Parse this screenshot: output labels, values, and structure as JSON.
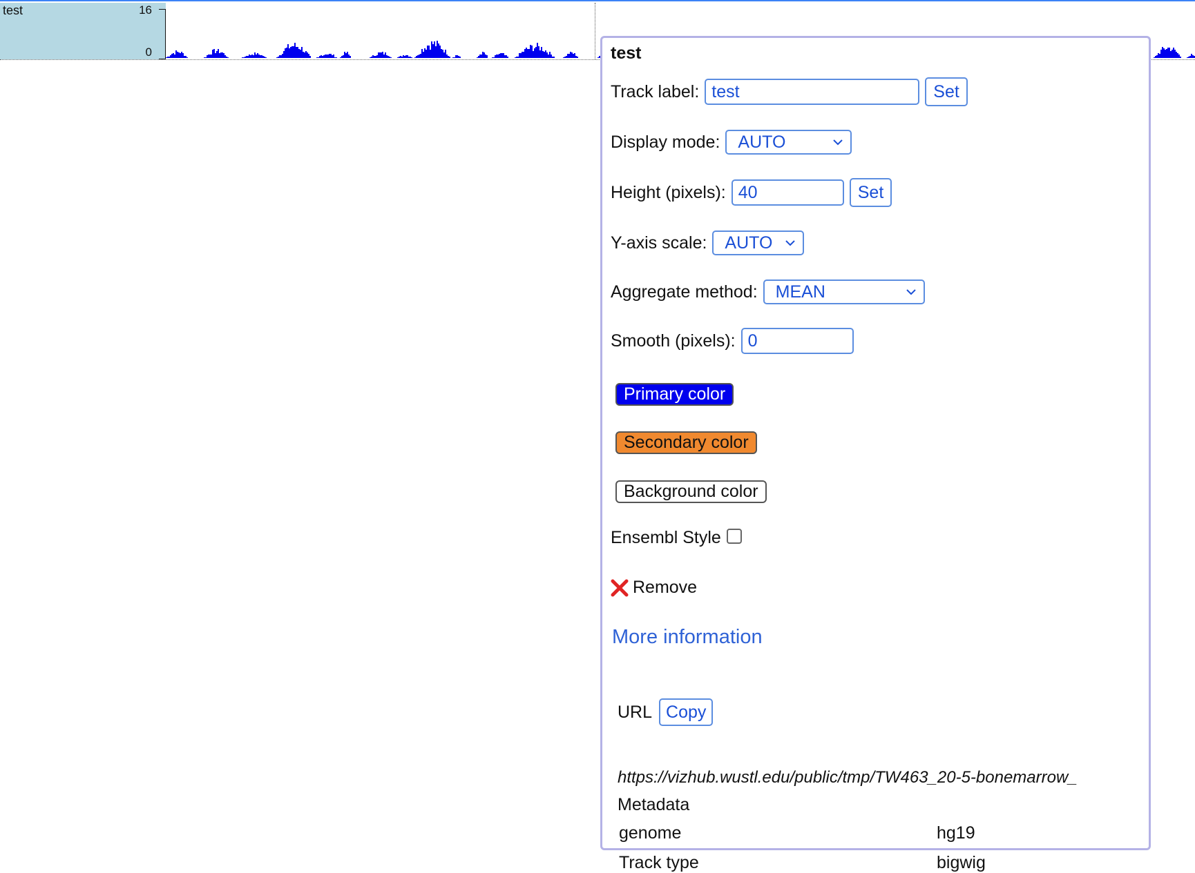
{
  "track": {
    "label": "test",
    "ymax": "16",
    "ymin": "0",
    "color": "#0000ee"
  },
  "panel": {
    "title": "test",
    "track_label": {
      "label": "Track label:",
      "value": "test",
      "set_label": "Set"
    },
    "display_mode": {
      "label": "Display mode:",
      "value": "AUTO"
    },
    "height": {
      "label": "Height (pixels):",
      "value": "40",
      "set_label": "Set"
    },
    "y_axis_scale": {
      "label": "Y-axis scale:",
      "value": "AUTO"
    },
    "aggregate_method": {
      "label": "Aggregate method:",
      "value": "MEAN"
    },
    "smooth": {
      "label": "Smooth (pixels):",
      "value": "0"
    },
    "primary_color": {
      "label": "Primary color",
      "color": "#0000ee"
    },
    "secondary_color": {
      "label": "Secondary color",
      "color": "#f0892f"
    },
    "background_color": {
      "label": "Background color",
      "color": "#ffffff"
    },
    "ensembl_style": {
      "label": "Ensembl Style",
      "checked": false
    },
    "remove": {
      "label": "Remove",
      "icon": "close-x-icon"
    },
    "more_info": "More information",
    "url": {
      "label": "URL",
      "copy_label": "Copy",
      "value": "https://vizhub.wustl.edu/public/tmp/TW463_20-5-bonemarrow_"
    },
    "metadata": {
      "title": "Metadata",
      "rows": [
        {
          "key": "genome",
          "value": "hg19"
        },
        {
          "key": "Track type",
          "value": "bigwig"
        }
      ]
    }
  },
  "colors": {
    "accent": "#1a4fd6",
    "panel_border": "#b4b2e6",
    "legend_bg": "#b5d8e3",
    "remove_icon": "#e02424"
  }
}
